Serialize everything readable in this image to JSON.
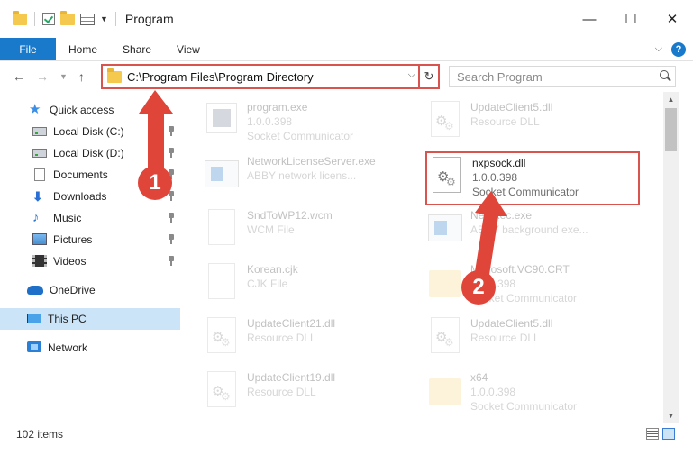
{
  "window": {
    "title": "Program",
    "minimize": "—",
    "maximize": "☐",
    "close": "✕"
  },
  "ribbon": {
    "file": "File",
    "tabs": [
      "Home",
      "Share",
      "View"
    ],
    "help": "?"
  },
  "address": {
    "path": "C:\\Program Files\\Program Directory",
    "search_placeholder": "Search Program"
  },
  "sidebar": {
    "items": [
      {
        "label": "Quick access",
        "icon": "star-icon"
      },
      {
        "label": "Local Disk (C:)",
        "icon": "disk-icon",
        "pinned": true
      },
      {
        "label": "Local Disk (D:)",
        "icon": "disk-icon",
        "pinned": true
      },
      {
        "label": "Documents",
        "icon": "documents-icon",
        "pinned": true
      },
      {
        "label": "Downloads",
        "icon": "downloads-icon",
        "pinned": true
      },
      {
        "label": "Music",
        "icon": "music-icon",
        "pinned": true
      },
      {
        "label": "Pictures",
        "icon": "pictures-icon",
        "pinned": true
      },
      {
        "label": "Videos",
        "icon": "videos-icon",
        "pinned": true
      },
      {
        "label": "OneDrive",
        "icon": "onedrive-icon"
      },
      {
        "label": "This PC",
        "icon": "pc-icon",
        "selected": true
      },
      {
        "label": "Network",
        "icon": "network-icon"
      }
    ]
  },
  "files": [
    {
      "name": "program.exe",
      "line2": "1.0.0.398",
      "line3": "Socket Communicator",
      "icon": "exe-icon"
    },
    {
      "name": "UpdateClient5.dll",
      "line2": "Resource DLL",
      "line3": "",
      "icon": "dll-icon"
    },
    {
      "name": "NetworkLicenseServer.exe",
      "line2": "ABBY network licens...",
      "line3": "",
      "icon": "exe-icon"
    },
    {
      "name": "nxpsock.dll",
      "line2": "1.0.0.398",
      "line3": "Socket Communicator",
      "icon": "dll-icon"
    },
    {
      "name": "SndToWP12.wcm",
      "line2": "WCM File",
      "line3": "",
      "icon": "blank-icon"
    },
    {
      "name": "NetExec.exe",
      "line2": "ABBY background exe...",
      "line3": "",
      "icon": "exe-icon"
    },
    {
      "name": "Korean.cjk",
      "line2": "CJK File",
      "line3": "",
      "icon": "blank-icon"
    },
    {
      "name": "Microsoft.VC90.CRT",
      "line2": "1.0.0.398",
      "line3": "Socket Communicator",
      "icon": "folder-icon"
    },
    {
      "name": "UpdateClient21.dll",
      "line2": "Resource DLL",
      "line3": "",
      "icon": "dll-icon"
    },
    {
      "name": "UpdateClient5.dll",
      "line2": "Resource DLL",
      "line3": "",
      "icon": "dll-icon"
    },
    {
      "name": "UpdateClient19.dll",
      "line2": "Resource DLL",
      "line3": "",
      "icon": "dll-icon"
    },
    {
      "name": "x64",
      "line2": "1.0.0.398",
      "line3": "Socket Communicator",
      "icon": "folder-icon"
    }
  ],
  "status": {
    "count": "102 items"
  },
  "annotations": {
    "step1": "1",
    "step2": "2",
    "color": "#e0453a"
  }
}
